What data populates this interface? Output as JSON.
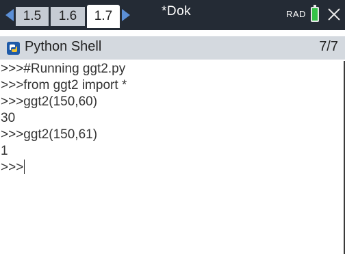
{
  "tabbar": {
    "tabs": [
      {
        "label": "1.5"
      },
      {
        "label": "1.6"
      },
      {
        "label": "1.7"
      }
    ],
    "document_title": "*Dok",
    "angle_mode": "RAD",
    "colors": {
      "background": "#242b35",
      "arrow": "#5b8fd6",
      "battery": "#34c247"
    }
  },
  "shell": {
    "title": "Python Shell",
    "page_indicator": "7/7",
    "icon": "python-icon"
  },
  "console": {
    "lines": [
      ">>>#Running ggt2.py",
      ">>>from ggt2 import *",
      ">>>ggt2(150,60)",
      "30",
      ">>>ggt2(150,61)",
      "1",
      ">>>"
    ]
  }
}
